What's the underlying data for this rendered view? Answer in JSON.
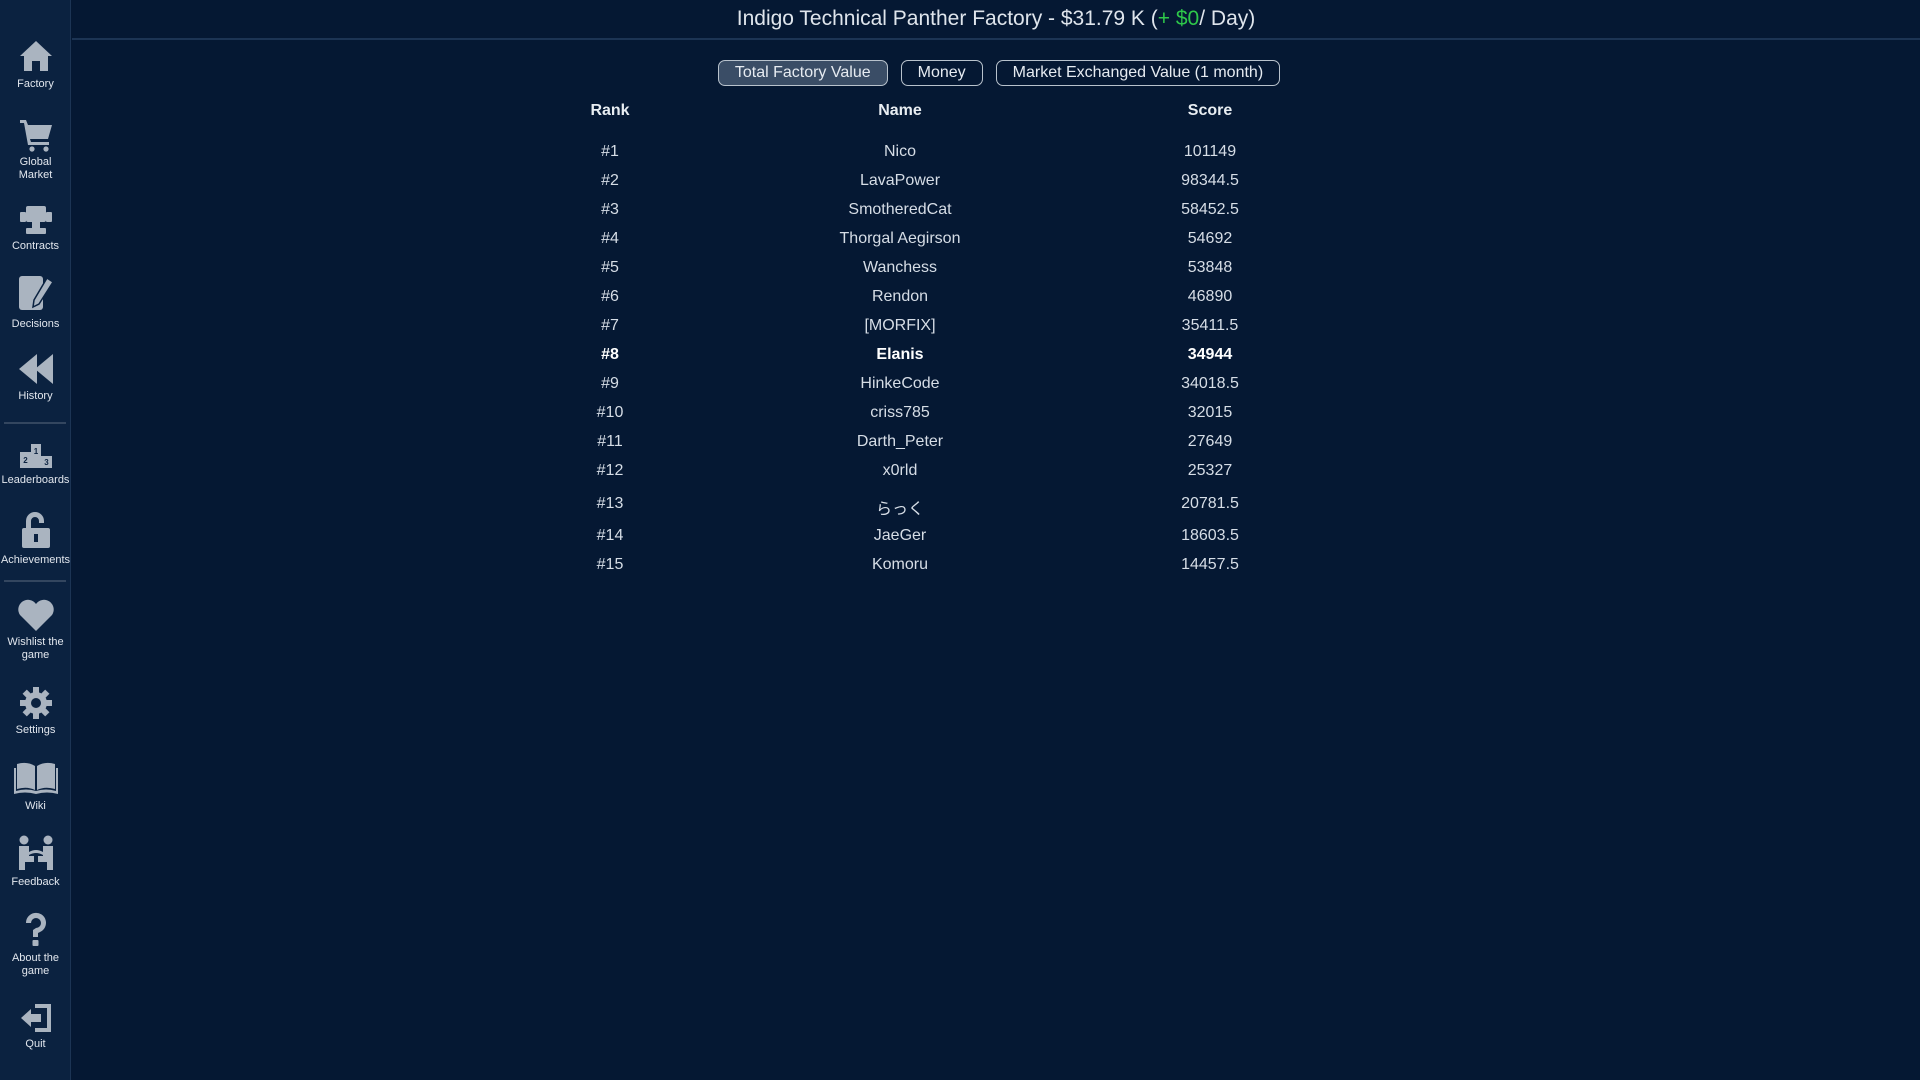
{
  "header": {
    "title_main": "Indigo Technical Panther Factory - $31.79 K (",
    "income": "+ $0",
    "title_tail": " / Day)"
  },
  "sidebar": {
    "items": [
      {
        "label": "Factory",
        "icon": "home-icon"
      },
      {
        "label": "Global\nMarket",
        "icon": "cart-icon"
      },
      {
        "label": "Contracts",
        "icon": "contracts-icon"
      },
      {
        "label": "Decisions",
        "icon": "decisions-icon"
      },
      {
        "label": "History",
        "icon": "rewind-icon"
      },
      {
        "label": "Leaderboards",
        "icon": "podium-icon"
      },
      {
        "label": "Achievements",
        "icon": "lock-open-icon"
      },
      {
        "label": "Wishlist the\ngame",
        "icon": "heart-icon"
      },
      {
        "label": "Settings",
        "icon": "gear-icon"
      },
      {
        "label": "Wiki",
        "icon": "book-icon"
      },
      {
        "label": "Feedback",
        "icon": "feedback-icon"
      },
      {
        "label": "About the\ngame",
        "icon": "question-icon"
      },
      {
        "label": "Quit",
        "icon": "quit-icon"
      }
    ]
  },
  "filters": [
    {
      "label": "Total Factory Value",
      "active": true
    },
    {
      "label": "Money",
      "active": false
    },
    {
      "label": "Market Exchanged Value (1 month)",
      "active": false
    }
  ],
  "leaderboard": {
    "columns": {
      "rank": "Rank",
      "name": "Name",
      "score": "Score"
    },
    "rows": [
      {
        "rank": "#1",
        "name": "Nico",
        "score": "101149"
      },
      {
        "rank": "#2",
        "name": "LavaPower",
        "score": "98344.5"
      },
      {
        "rank": "#3",
        "name": "SmotheredCat",
        "score": "58452.5"
      },
      {
        "rank": "#4",
        "name": "Thorgal Aegirson",
        "score": "54692"
      },
      {
        "rank": "#5",
        "name": "Wanchess",
        "score": "53848"
      },
      {
        "rank": "#6",
        "name": "Rendon",
        "score": "46890"
      },
      {
        "rank": "#7",
        "name": "[MORFIX]",
        "score": "35411.5"
      },
      {
        "rank": "#8",
        "name": "Elanis",
        "score": "34944",
        "current_player": true
      },
      {
        "rank": "#9",
        "name": "HinkeCode",
        "score": "34018.5"
      },
      {
        "rank": "#10",
        "name": "criss785",
        "score": "32015"
      },
      {
        "rank": "#11",
        "name": "Darth_Peter",
        "score": "27649"
      },
      {
        "rank": "#12",
        "name": "x0rld",
        "score": "25327"
      },
      {
        "rank": "#13",
        "name": "らっく",
        "score": "20781.5"
      },
      {
        "rank": "#14",
        "name": "JaeGer",
        "score": "18603.5"
      },
      {
        "rank": "#15",
        "name": "Komoru",
        "score": "14457.5"
      }
    ]
  }
}
